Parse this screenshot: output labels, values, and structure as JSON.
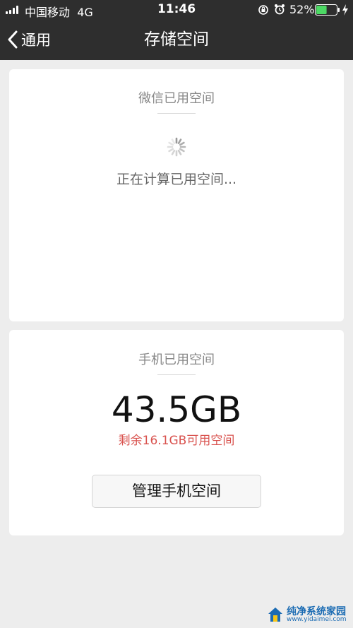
{
  "status_bar": {
    "carrier": "中国移动",
    "network": "4G",
    "time": "11:46",
    "battery_percent": "52%",
    "battery_level": 0.52,
    "battery_color": "#4cd964"
  },
  "nav": {
    "back_label": "通用",
    "title": "存储空间"
  },
  "wechat_storage": {
    "title": "微信已用空间",
    "calculating_text": "正在计算已用空间..."
  },
  "phone_storage": {
    "title": "手机已用空间",
    "used": "43.5GB",
    "remaining": "剩余16.1GB可用空间",
    "remaining_color": "#d9534f",
    "manage_button": "管理手机空间"
  },
  "watermark": {
    "main": "纯净系统家园",
    "sub": "www.yidaimei.com"
  }
}
